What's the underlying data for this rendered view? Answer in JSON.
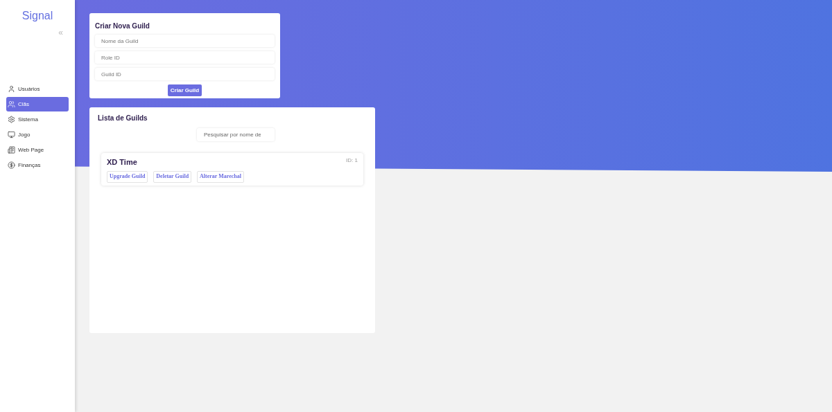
{
  "sidebar": {
    "brand": "Signal",
    "collapse_icon": "«",
    "items": [
      {
        "label": "Usuários",
        "selected": false
      },
      {
        "label": "Clãs",
        "selected": true
      },
      {
        "label": "Sistema",
        "selected": false
      },
      {
        "label": "Jogo",
        "selected": false
      },
      {
        "label": "Web Page",
        "selected": false
      },
      {
        "label": "Finanças",
        "selected": false
      }
    ]
  },
  "create_card": {
    "title": "Criar Nova Guild",
    "fields": [
      {
        "placeholder": "Nome da Guild"
      },
      {
        "placeholder": "Role ID"
      },
      {
        "placeholder": "Guild ID"
      }
    ],
    "submit": "Criar Guild"
  },
  "list_card": {
    "title": "Lista de Guilds",
    "search": {
      "placeholder": "Pesquisar por nome de"
    },
    "guilds": [
      {
        "name": "XD Time",
        "id_label": "ID: 1",
        "actions": [
          "Upgrade Guild",
          "Deletar Guild",
          "Alterar Marechal"
        ]
      }
    ]
  }
}
